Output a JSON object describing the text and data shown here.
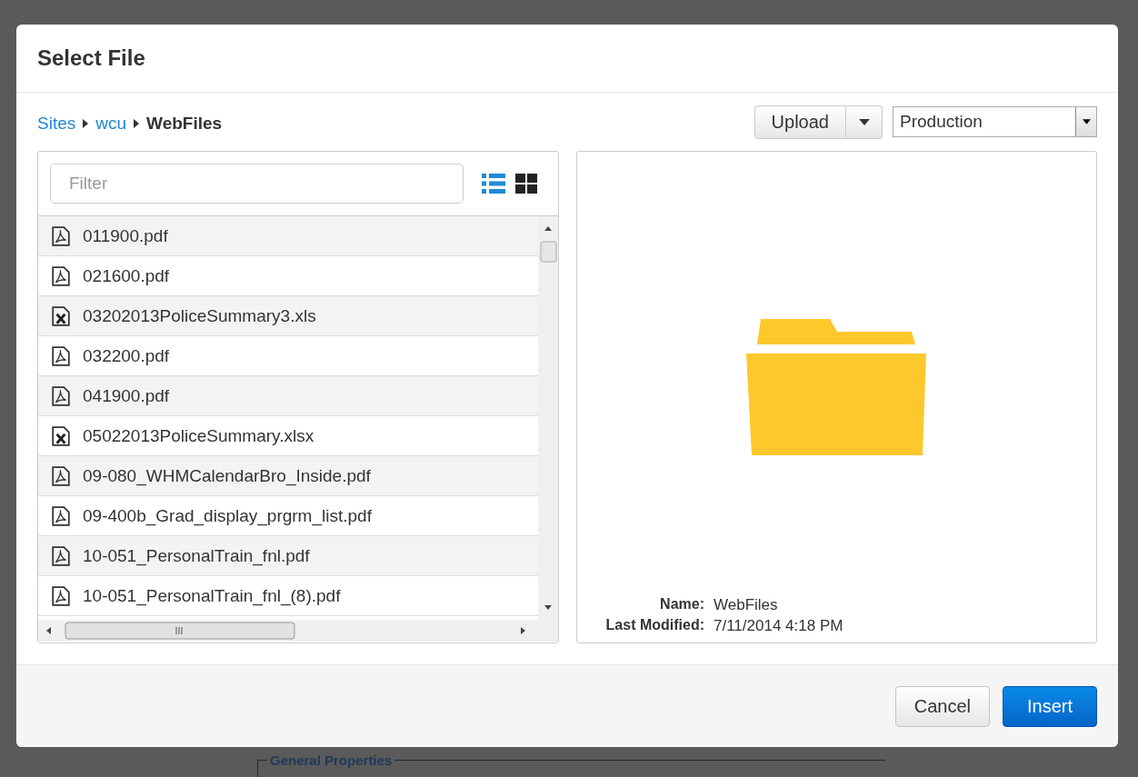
{
  "background": {
    "legend": "General Properties"
  },
  "dialog": {
    "title": "Select File",
    "breadcrumb": [
      {
        "label": "Sites",
        "kind": "link"
      },
      {
        "label": "wcu",
        "kind": "link"
      },
      {
        "label": "WebFiles",
        "kind": "current"
      }
    ],
    "upload_button": "Upload",
    "environment_select": {
      "value": "Production"
    },
    "filter": {
      "placeholder": "Filter"
    },
    "view_modes": [
      {
        "kind": "list",
        "selected": true
      },
      {
        "kind": "grid",
        "selected": false
      }
    ],
    "files": [
      {
        "name": "011900.pdf",
        "kind": "pdf"
      },
      {
        "name": "021600.pdf",
        "kind": "pdf"
      },
      {
        "name": "03202013PoliceSummary3.xls",
        "kind": "xls"
      },
      {
        "name": "032200.pdf",
        "kind": "pdf"
      },
      {
        "name": "041900.pdf",
        "kind": "pdf"
      },
      {
        "name": "05022013PoliceSummary.xlsx",
        "kind": "xls"
      },
      {
        "name": "09-080_WHMCalendarBro_Inside.pdf",
        "kind": "pdf"
      },
      {
        "name": "09-400b_Grad_display_prgrm_list.pdf",
        "kind": "pdf"
      },
      {
        "name": "10-051_PersonalTrain_fnl.pdf",
        "kind": "pdf"
      },
      {
        "name": "10-051_PersonalTrain_fnl_(8).pdf",
        "kind": "pdf"
      }
    ],
    "details": [
      {
        "label": "Name:",
        "value": "WebFiles"
      },
      {
        "label": "Last Modified:",
        "value": "7/11/2014 4:18 PM"
      }
    ],
    "buttons": [
      {
        "label": "Cancel",
        "kind": "default"
      },
      {
        "label": "Insert",
        "kind": "primary"
      }
    ]
  }
}
